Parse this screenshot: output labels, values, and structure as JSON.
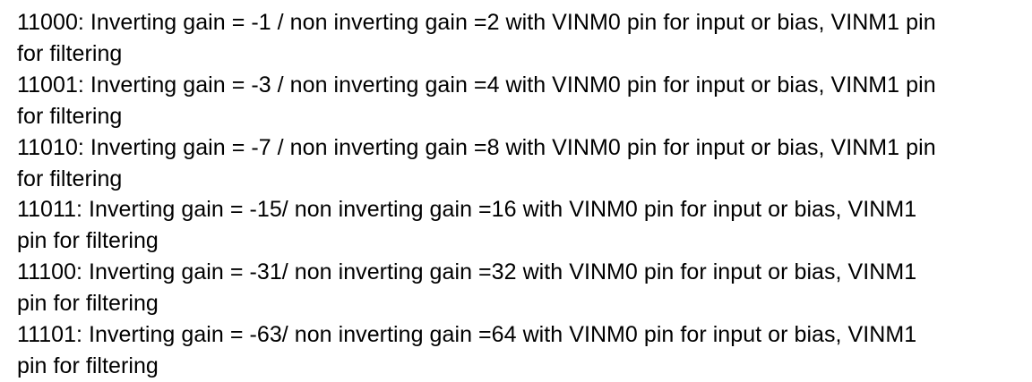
{
  "entries": [
    {
      "line1": "11000: Inverting gain = -1 / non inverting gain =2 with VINM0 pin for input or bias, VINM1 pin",
      "line2": "for filtering"
    },
    {
      "line1": "11001: Inverting gain = -3 / non inverting gain =4 with VINM0 pin for input or bias, VINM1 pin",
      "line2": "for filtering"
    },
    {
      "line1": "11010: Inverting gain = -7 / non inverting gain =8 with VINM0 pin for input or bias, VINM1 pin",
      "line2": "for filtering"
    },
    {
      "line1": "11011: Inverting gain = -15/ non inverting gain =16 with VINM0 pin for input or bias, VINM1",
      "line2": "pin for filtering"
    },
    {
      "line1": "11100: Inverting gain = -31/ non inverting gain =32 with VINM0 pin for input or bias, VINM1",
      "line2": "pin for filtering"
    },
    {
      "line1": "11101: Inverting gain = -63/ non inverting gain =64 with VINM0 pin for input or bias, VINM1",
      "line2": "pin for filtering"
    }
  ]
}
